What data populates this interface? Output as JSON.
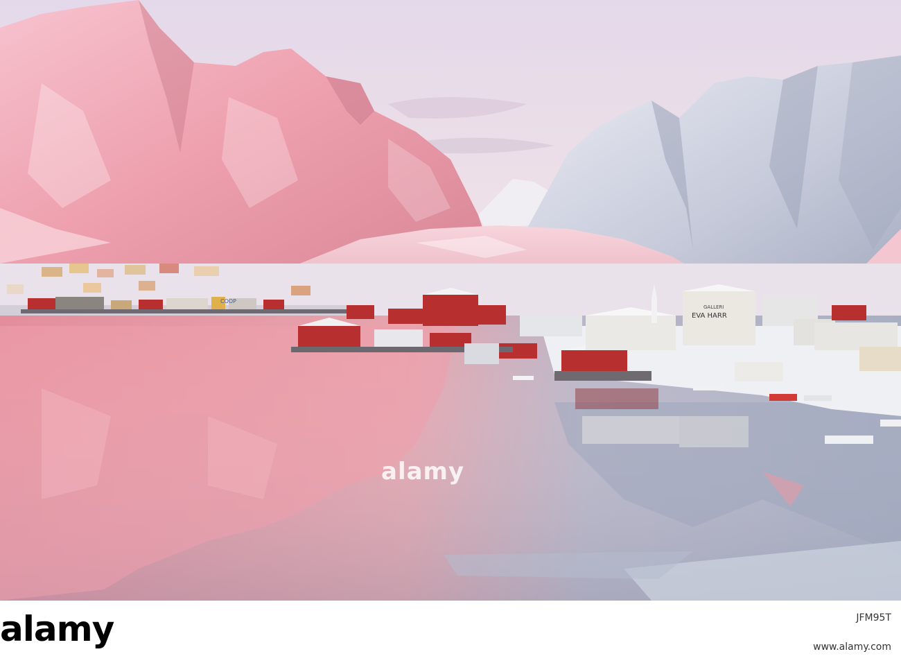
{
  "photo": {
    "sign_gallery": "GALLERI",
    "sign_name": "EVA HARR",
    "sign_store": "COOP",
    "colors": {
      "sky_top": "#e6d9ec",
      "sky_bottom": "#f3e2e6",
      "mountain_pink": "#f2a8b4",
      "mountain_snow": "#fbe9ef",
      "mountain_shadow": "#b98a9a",
      "mountain_blue": "#d4dbe8",
      "water_pink": "#e89aa6",
      "water_blue": "#aeb4c8",
      "house_red": "#b72f2e",
      "house_white": "#eef0f2"
    }
  },
  "watermark": {
    "text": "alamy"
  },
  "footer": {
    "logo": "alamy",
    "image_id": "JFM95T",
    "site": "www.alamy.com"
  }
}
